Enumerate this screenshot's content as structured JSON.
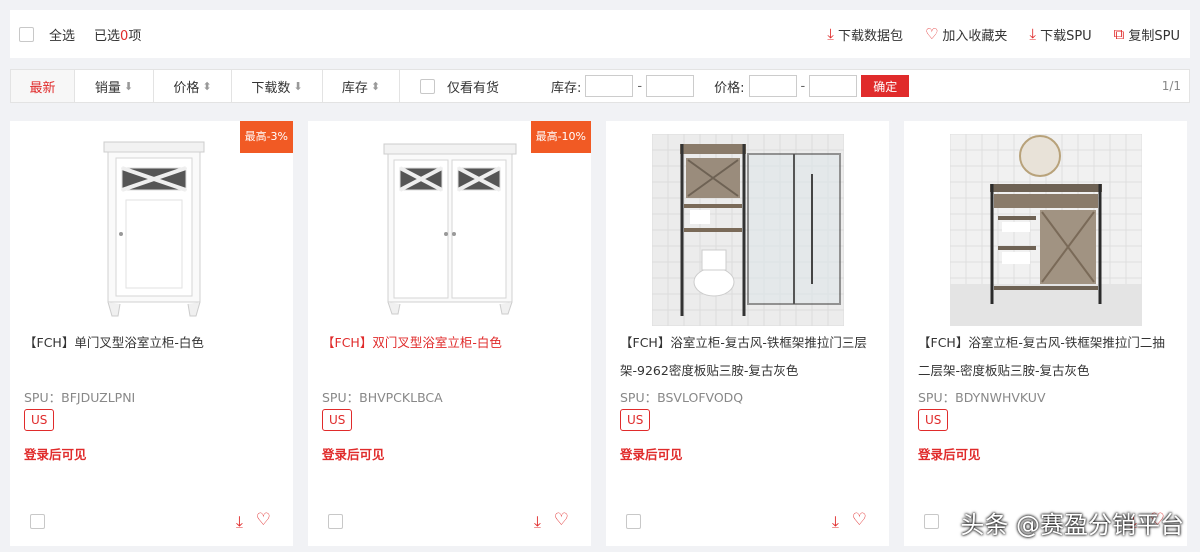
{
  "toolbar": {
    "select_all": "全选",
    "selected_prefix": "已选",
    "selected_count": "0",
    "selected_suffix": "项",
    "actions": [
      {
        "icon": "download-icon",
        "glyph": "⤓",
        "label": "下载数据包"
      },
      {
        "icon": "heart-icon",
        "glyph": "♡",
        "label": "加入收藏夹"
      },
      {
        "icon": "download-icon",
        "glyph": "⤓",
        "label": "下载SPU"
      },
      {
        "icon": "copy-icon",
        "glyph": "⧉",
        "label": "复制SPU"
      }
    ]
  },
  "filters": {
    "sorts": [
      {
        "label": "最新",
        "arrow": ""
      },
      {
        "label": "销量",
        "arrow": "⬇"
      },
      {
        "label": "价格",
        "arrow": "⬍"
      },
      {
        "label": "下载数",
        "arrow": "⬇"
      },
      {
        "label": "库存",
        "arrow": "⬍"
      }
    ],
    "in_stock_label": "仅看有货",
    "stock_label": "库存:",
    "price_label": "价格:",
    "confirm": "确定",
    "page": "1/1"
  },
  "products": [
    {
      "badge": "最高-3%",
      "title": "【FCH】单门叉型浴室立柜-白色",
      "title_red": false,
      "spu": "SPU：BFJDUZLPNI",
      "region": "US",
      "login": "登录后可见"
    },
    {
      "badge": "最高-10%",
      "title": "【FCH】双门叉型浴室立柜-白色",
      "title_red": true,
      "spu": "SPU：BHVPCKLBCA",
      "region": "US",
      "login": "登录后可见"
    },
    {
      "badge": "",
      "title": "【FCH】浴室立柜-复古风-铁框架推拉门三层架-9262密度板贴三胺-复古灰色",
      "title_red": false,
      "spu": "SPU：BSVLOFVODQ",
      "region": "US",
      "login": "登录后可见"
    },
    {
      "badge": "",
      "title": "【FCH】浴室立柜-复古风-铁框架推拉门二抽二层架-密度板贴三胺-复古灰色",
      "title_red": false,
      "spu": "SPU：BDYNWHVKUV",
      "region": "US",
      "login": "登录后可见"
    }
  ],
  "watermark": "头条 @赛盈分销平台"
}
